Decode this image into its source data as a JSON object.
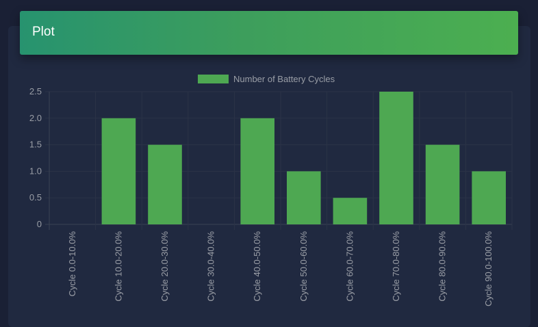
{
  "card": {
    "title": "Plot"
  },
  "chart_data": {
    "type": "bar",
    "categories": [
      "Cycle 0.0-10.0%",
      "Cycle 10.0-20.0%",
      "Cycle 20.0-30.0%",
      "Cycle 30.0-40.0%",
      "Cycle 40.0-50.0%",
      "Cycle 50.0-60.0%",
      "Cycle 60.0-70.0%",
      "Cycle 70.0-80.0%",
      "Cycle 80.0-90.0%",
      "Cycle 90.0-100.0%"
    ],
    "series": [
      {
        "name": "Number of Battery Cycles",
        "values": [
          0,
          2,
          1.5,
          0,
          2,
          1,
          0.5,
          2.5,
          1.5,
          1
        ],
        "color": "#4ea852"
      }
    ],
    "yticks": [
      "0",
      "0.5",
      "1.0",
      "1.5",
      "2.0",
      "2.5"
    ],
    "ylim": [
      0,
      2.5
    ],
    "grid": true,
    "legend": "top-center"
  }
}
